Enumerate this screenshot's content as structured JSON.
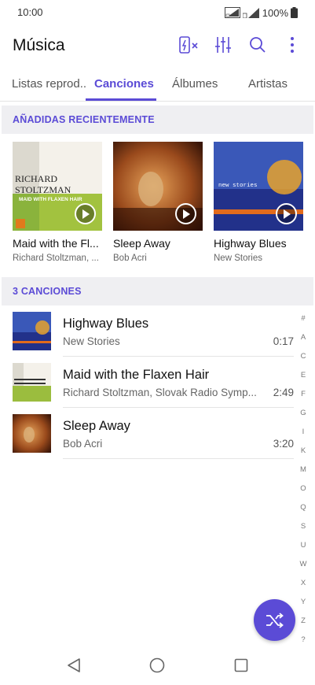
{
  "status_bar": {
    "time": "10:00",
    "battery": "100%"
  },
  "app_bar": {
    "title": "Música"
  },
  "tabs": [
    {
      "label": "Listas reprod.."
    },
    {
      "label": "Canciones"
    },
    {
      "label": "Álbumes"
    },
    {
      "label": "Artistas"
    }
  ],
  "recent": {
    "header": "AÑADIDAS RECIENTEMENTE",
    "items": [
      {
        "title": "Maid with the Fl...",
        "artist": "Richard Stoltzman, ...",
        "cover_text": [
          "RICHARD",
          "STOLTZMAN",
          "MAID WITH FLAXEN HAIR"
        ]
      },
      {
        "title": "Sleep Away",
        "artist": "Bob Acri"
      },
      {
        "title": "Highway Blues",
        "artist": "New Stories",
        "cover_text": [
          "new stories"
        ]
      }
    ]
  },
  "songs": {
    "header": "3 CANCIONES",
    "items": [
      {
        "title": "Highway Blues",
        "artist": "New Stories",
        "duration": "0:17"
      },
      {
        "title": "Maid with the Flaxen Hair",
        "artist": "Richard Stoltzman, Slovak Radio Symp...",
        "duration": "2:49"
      },
      {
        "title": "Sleep Away",
        "artist": "Bob Acri",
        "duration": "3:20"
      }
    ]
  },
  "alpha_index": [
    "#",
    "A",
    "C",
    "E",
    "F",
    "G",
    "I",
    "K",
    "M",
    "O",
    "Q",
    "S",
    "U",
    "W",
    "X",
    "Y",
    "Z",
    "?"
  ],
  "colors": {
    "accent": "#5b4bd6",
    "section_bg": "#efeff2"
  }
}
